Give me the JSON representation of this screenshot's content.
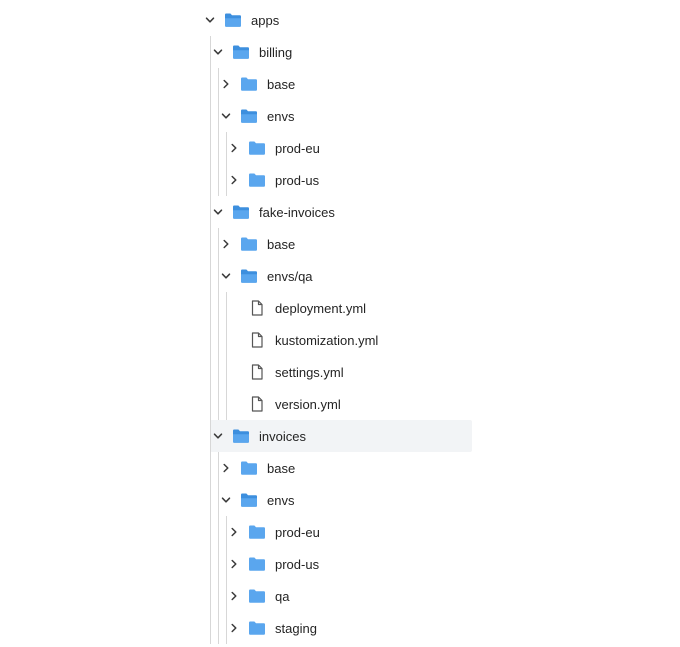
{
  "tree": {
    "rows": [
      {
        "label": "apps",
        "type": "folder",
        "state": "expanded",
        "depth": 0
      },
      {
        "label": "billing",
        "type": "folder",
        "state": "expanded",
        "depth": 1
      },
      {
        "label": "base",
        "type": "folder",
        "state": "collapsed",
        "depth": 2
      },
      {
        "label": "envs",
        "type": "folder",
        "state": "expanded",
        "depth": 2
      },
      {
        "label": "prod-eu",
        "type": "folder",
        "state": "collapsed",
        "depth": 3
      },
      {
        "label": "prod-us",
        "type": "folder",
        "state": "collapsed",
        "depth": 3
      },
      {
        "label": "fake-invoices",
        "type": "folder",
        "state": "expanded",
        "depth": 1
      },
      {
        "label": "base",
        "type": "folder",
        "state": "collapsed",
        "depth": 2
      },
      {
        "label": "envs/qa",
        "type": "folder",
        "state": "expanded",
        "depth": 2
      },
      {
        "label": "deployment.yml",
        "type": "file",
        "state": "none",
        "depth": 3
      },
      {
        "label": "kustomization.yml",
        "type": "file",
        "state": "none",
        "depth": 3
      },
      {
        "label": "settings.yml",
        "type": "file",
        "state": "none",
        "depth": 3
      },
      {
        "label": "version.yml",
        "type": "file",
        "state": "none",
        "depth": 3
      },
      {
        "label": "invoices",
        "type": "folder",
        "state": "expanded",
        "depth": 1,
        "selected": true
      },
      {
        "label": "base",
        "type": "folder",
        "state": "collapsed",
        "depth": 2
      },
      {
        "label": "envs",
        "type": "folder",
        "state": "expanded",
        "depth": 2
      },
      {
        "label": "prod-eu",
        "type": "folder",
        "state": "collapsed",
        "depth": 3
      },
      {
        "label": "prod-us",
        "type": "folder",
        "state": "collapsed",
        "depth": 3
      },
      {
        "label": "qa",
        "type": "folder",
        "state": "collapsed",
        "depth": 3
      },
      {
        "label": "staging",
        "type": "folder",
        "state": "collapsed",
        "depth": 3
      }
    ]
  },
  "icons": {
    "folder": "folder-icon",
    "file": "file-icon",
    "expanded": "chevron-down-icon",
    "collapsed": "chevron-right-icon"
  },
  "colors": {
    "folder": "#5aa6ee",
    "folder_dark": "#3d8fde",
    "chevron": "#3a3a3a",
    "file_stroke": "#555555",
    "guide": "#d7d7d7",
    "selected_bg": "#f2f4f6"
  }
}
